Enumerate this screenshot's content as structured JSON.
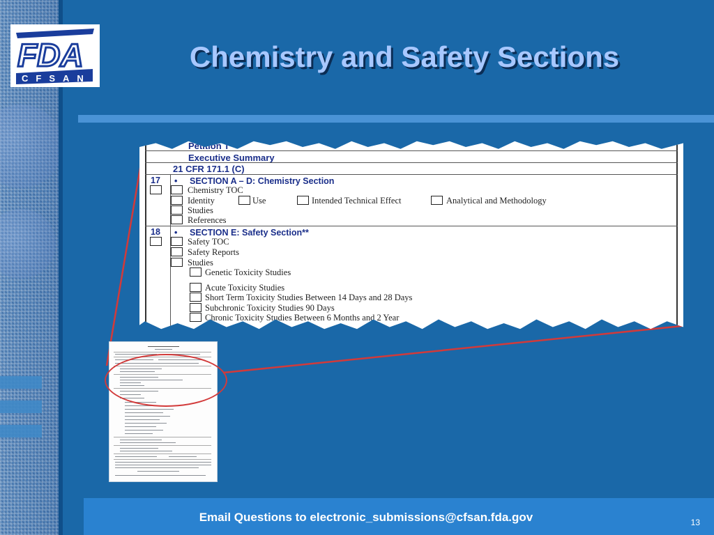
{
  "slide": {
    "title": "Chemistry and Safety Sections",
    "footer_text": "Email Questions to electronic_submissions@cfsan.fda.gov",
    "page_number": "13"
  },
  "logo": {
    "top_text": "FDA",
    "bottom_text": "CFSAN",
    "colors": {
      "primary": "#1a3d9c",
      "background": "#ffffff"
    }
  },
  "colors": {
    "background": "#1a68a8",
    "title": "#a8c8ff",
    "accent_rule": "#4a93d6",
    "footer_bar": "#2a82d0",
    "highlight_lines": "#d23a3a",
    "form_heading": "#1a2e8a"
  },
  "zoomed_form": {
    "headers": [
      "Petition T",
      "Executive Summary",
      "21 CFR 171.1 (C)"
    ],
    "section_17": {
      "number": "17",
      "title": "SECTION A – D: Chemistry Section",
      "items": [
        "Chemistry TOC",
        "Identity",
        "Use",
        "Intended Technical Effect",
        "Analytical and Methodology",
        "Studies",
        "References"
      ]
    },
    "section_18": {
      "number": "18",
      "title": "SECTION E: Safety Section**",
      "items": [
        "Safety TOC",
        "Safety Reports",
        "Studies"
      ],
      "sub_items": [
        "Genetic Toxicity Studies",
        "Acute Toxicity Studies",
        "Short Term Toxicity Studies Between 14 Days and 28 Days",
        "Subchronic Toxicity Studies 90 Days",
        "Chronic Toxicity Studies Between 6 Months and 2 Year"
      ]
    }
  }
}
